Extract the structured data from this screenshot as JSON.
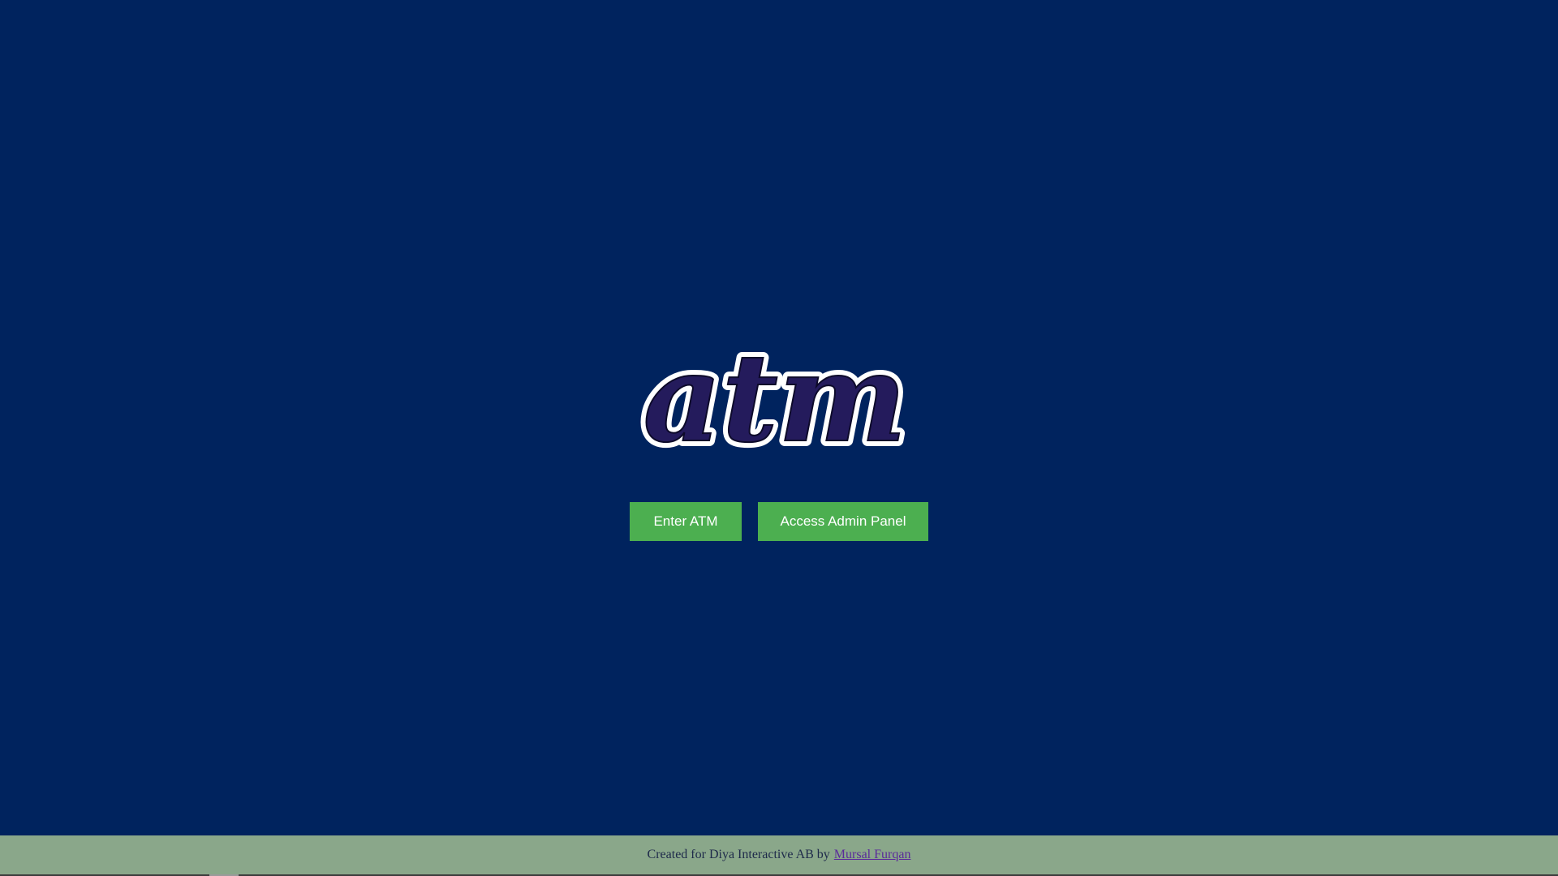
{
  "logo": {
    "text": "atm",
    "colors": {
      "outline": "#ffffff",
      "fill": "#241b5c"
    }
  },
  "actions": {
    "enter_label": "Enter ATM",
    "admin_label": "Access Admin Panel"
  },
  "footer": {
    "text": "Created for Diya Interactive AB by",
    "author_link": "Mursal Furqan"
  },
  "colors": {
    "background": "#00235e",
    "button": "#4caf50",
    "footer": "#8aa78a",
    "link": "#5a2a9a"
  }
}
